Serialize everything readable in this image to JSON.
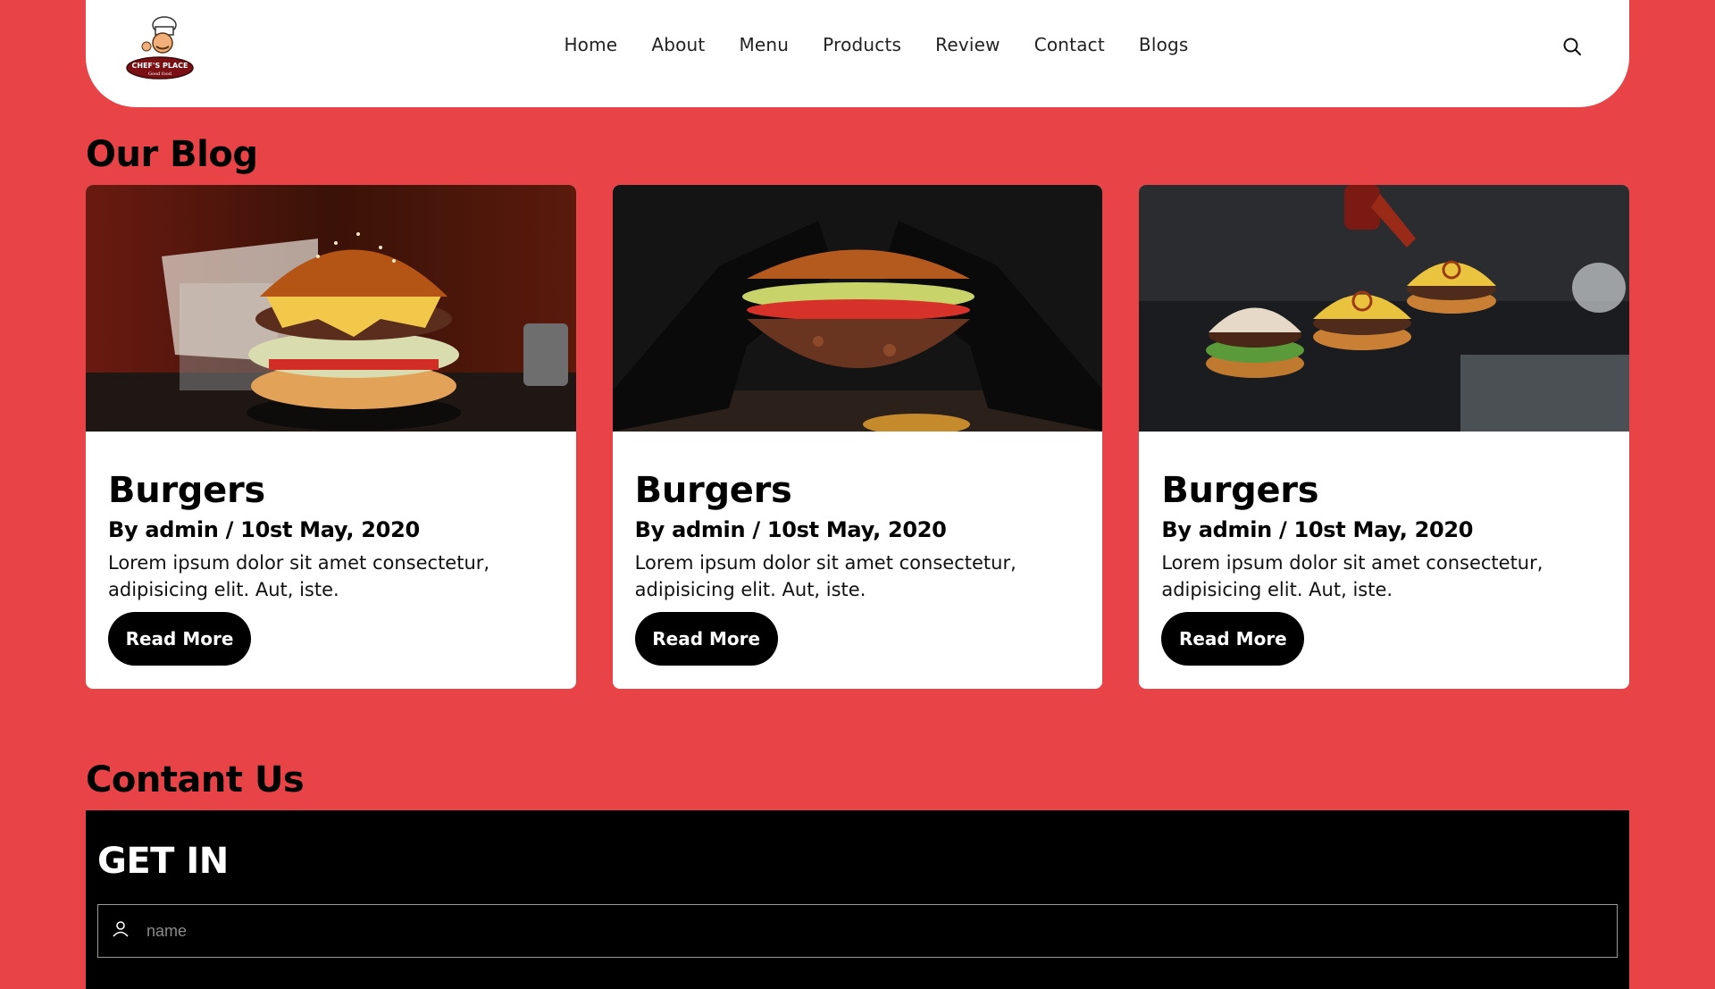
{
  "brand": {
    "logo_text_1": "CHEF'S PLACE",
    "logo_text_2": "Good food"
  },
  "nav": {
    "items": [
      "Home",
      "About",
      "Menu",
      "Products",
      "Review",
      "Contact",
      "Blogs"
    ]
  },
  "icons": {
    "search": "search-icon",
    "user": "user-icon"
  },
  "colors": {
    "background": "#e84347",
    "card": "#ffffff",
    "button": "#000000",
    "contact_bg": "#000000"
  },
  "blog": {
    "title": "Our Blog",
    "cards": [
      {
        "title": "Burgers",
        "meta": "By admin / 10st May, 2020",
        "text": "Lorem ipsum dolor sit amet consectetur, adipisicing elit. Aut, iste.",
        "button": "Read More"
      },
      {
        "title": "Burgers",
        "meta": "By admin / 10st May, 2020",
        "text": "Lorem ipsum dolor sit amet consectetur, adipisicing elit. Aut, iste.",
        "button": "Read More"
      },
      {
        "title": "Burgers",
        "meta": "By admin / 10st May, 2020",
        "text": "Lorem ipsum dolor sit amet consectetur, adipisicing elit. Aut, iste.",
        "button": "Read More"
      }
    ]
  },
  "contact": {
    "title": "Contant Us",
    "heading": "GET IN",
    "name_placeholder": "name"
  }
}
